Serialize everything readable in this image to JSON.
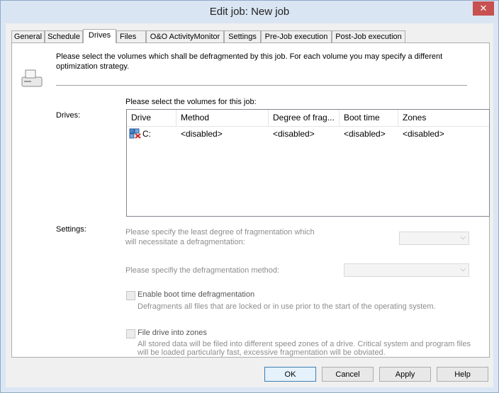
{
  "window": {
    "title": "Edit job: New job",
    "close_glyph": "✕"
  },
  "tabs": [
    {
      "label": "General"
    },
    {
      "label": "Schedule"
    },
    {
      "label": "Drives"
    },
    {
      "label": "Files"
    },
    {
      "label": "O&O ActivityMonitor"
    },
    {
      "label": "Settings"
    },
    {
      "label": "Pre-Job execution"
    },
    {
      "label": "Post-Job execution"
    }
  ],
  "drives_page": {
    "intro": "Please select the volumes which shall be defragmented by this job. For each volume you may specify a different optimization strategy.",
    "drives_label": "Drives:",
    "list_caption": "Please select the volumes for this job:",
    "columns": [
      "Drive",
      "Method",
      "Degree of frag...",
      "Boot time",
      "Zones"
    ],
    "rows": [
      {
        "drive": "C:",
        "method": "<disabled>",
        "degree": "<disabled>",
        "boot": "<disabled>",
        "zones": "<disabled>"
      }
    ],
    "settings_label": "Settings:",
    "degree_prompt_line1": "Please specify the least degree of fragmentation which",
    "degree_prompt_line2": "will necessitate a defragmentation:",
    "method_prompt": "Please specifiy the defragmentation method:",
    "boot_checkbox_label": "Enable boot time defragmentation",
    "boot_desc": "Defragments all files that are locked or in use prior to the start of the operating system.",
    "zones_checkbox_label": "File drive into zones",
    "zones_desc_line1": "All stored data will be filed into different speed zones of a drive. Critical system and program files",
    "zones_desc_line2": "will be loaded particularly fast, excessive fragmentation will be obviated."
  },
  "buttons": {
    "ok": "OK",
    "cancel": "Cancel",
    "apply": "Apply",
    "help": "Help"
  }
}
